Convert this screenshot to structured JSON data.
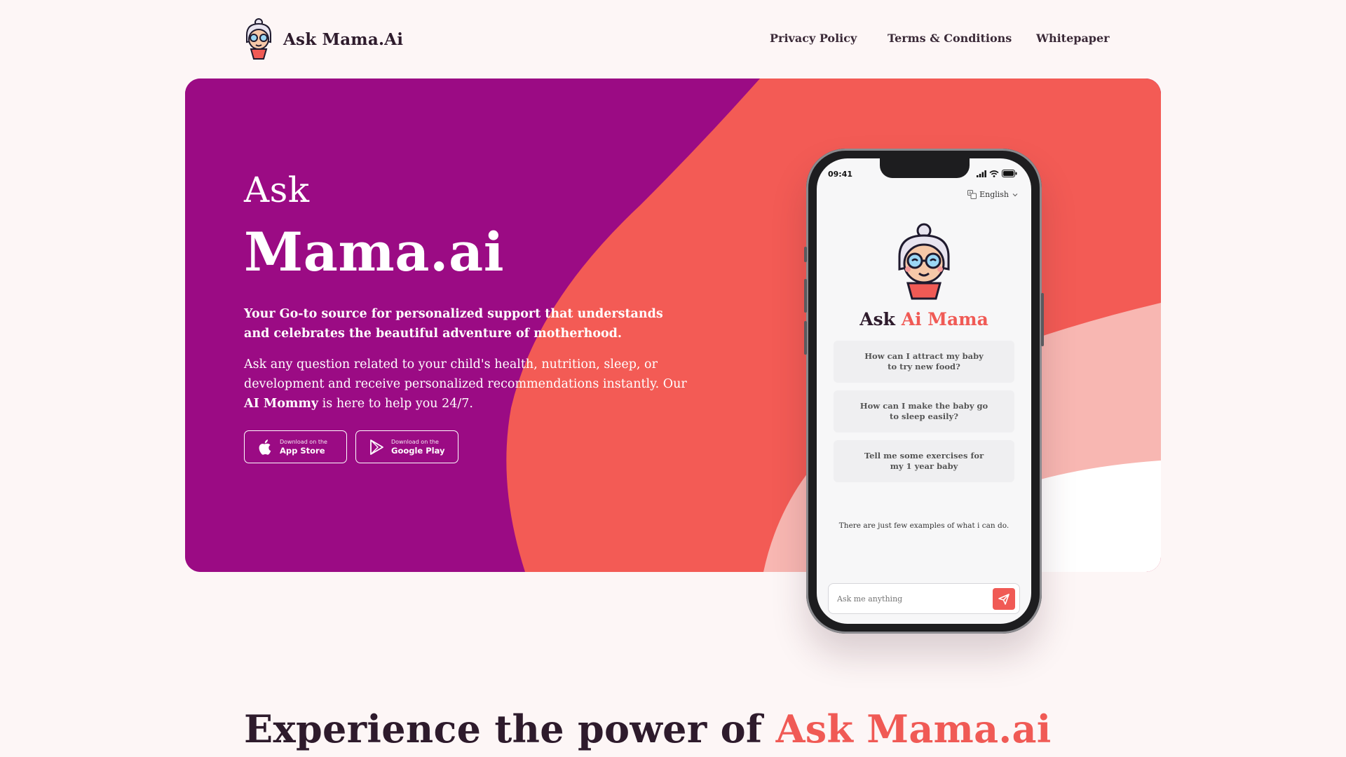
{
  "brand": {
    "name": "Ask Mama.Ai",
    "logo_icon": "grandma-mascot-icon"
  },
  "nav": [
    {
      "label": "Privacy Policy"
    },
    {
      "label": "Terms & Conditions"
    },
    {
      "label": "Whitepaper"
    }
  ],
  "hero": {
    "title_small": "Ask",
    "title_big": "Mama.ai",
    "tagline": "Your Go-to source for personalized support that understands and celebrates the beautiful adventure of motherhood.",
    "desc_before": "Ask any question related to your child's health, nutrition, sleep, or development and receive personalized recommendations instantly. Our ",
    "desc_bold": "AI Mommy",
    "desc_after": " is here to help you 24/7.",
    "colors": {
      "purple": "#9b0b84",
      "coral": "#f35b55",
      "pink": "#f8b7b2"
    },
    "app_store": {
      "small": "Download on the",
      "big": "App Store",
      "icon": "apple-icon"
    },
    "google_play": {
      "small": "Download on the",
      "big": "Google Play",
      "icon": "play-icon"
    }
  },
  "phone": {
    "time": "09:41",
    "language": "English",
    "title_part1": "Ask ",
    "title_part2": "Ai Mama",
    "suggestions": [
      "How can I attract my baby to try new food?",
      "How can I make the baby go to sleep easily?",
      "Tell me some exercises for my 1 year baby"
    ],
    "examples_note": "There are just few examples of what i can do.",
    "input_placeholder": "Ask me anything",
    "accent_color": "#f05a55"
  },
  "section": {
    "title_part1": "Experience the power of ",
    "title_part2": "Ask Mama.ai"
  }
}
